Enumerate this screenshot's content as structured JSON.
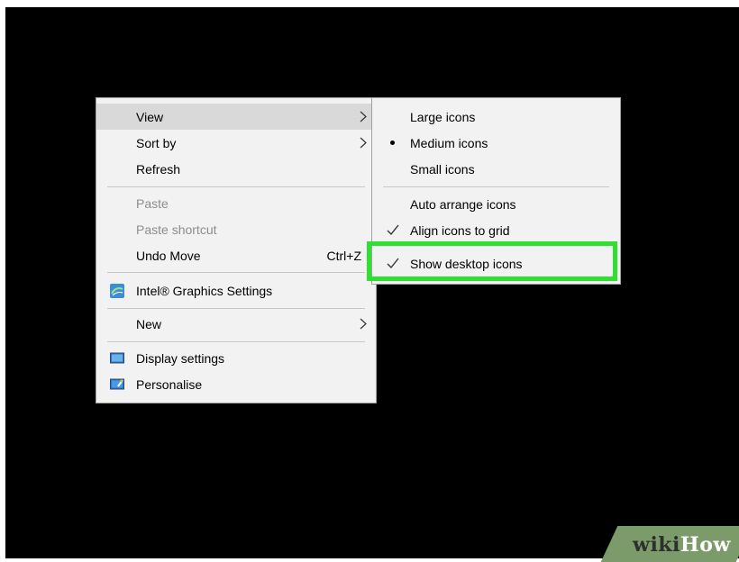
{
  "context_menu": {
    "items": {
      "view": "View",
      "sort_by": "Sort by",
      "refresh": "Refresh",
      "paste": "Paste",
      "paste_shortcut": "Paste shortcut",
      "undo_move": "Undo Move",
      "undo_move_shortcut": "Ctrl+Z",
      "intel_graphics": "Intel® Graphics Settings",
      "new": "New",
      "display_settings": "Display settings",
      "personalise": "Personalise"
    }
  },
  "view_submenu": {
    "items": {
      "large_icons": "Large icons",
      "medium_icons": "Medium icons",
      "small_icons": "Small icons",
      "auto_arrange": "Auto arrange icons",
      "align_grid": "Align icons to grid",
      "show_desktop_icons": "Show desktop icons"
    },
    "selected_size": "Medium icons",
    "checked": [
      "Align icons to grid",
      "Show desktop icons"
    ]
  },
  "watermark": {
    "part1": "wiki",
    "part2": "How"
  },
  "colors": {
    "highlight": "#30e030",
    "desktop": "#000000",
    "menu_bg": "#f2f2f2"
  }
}
